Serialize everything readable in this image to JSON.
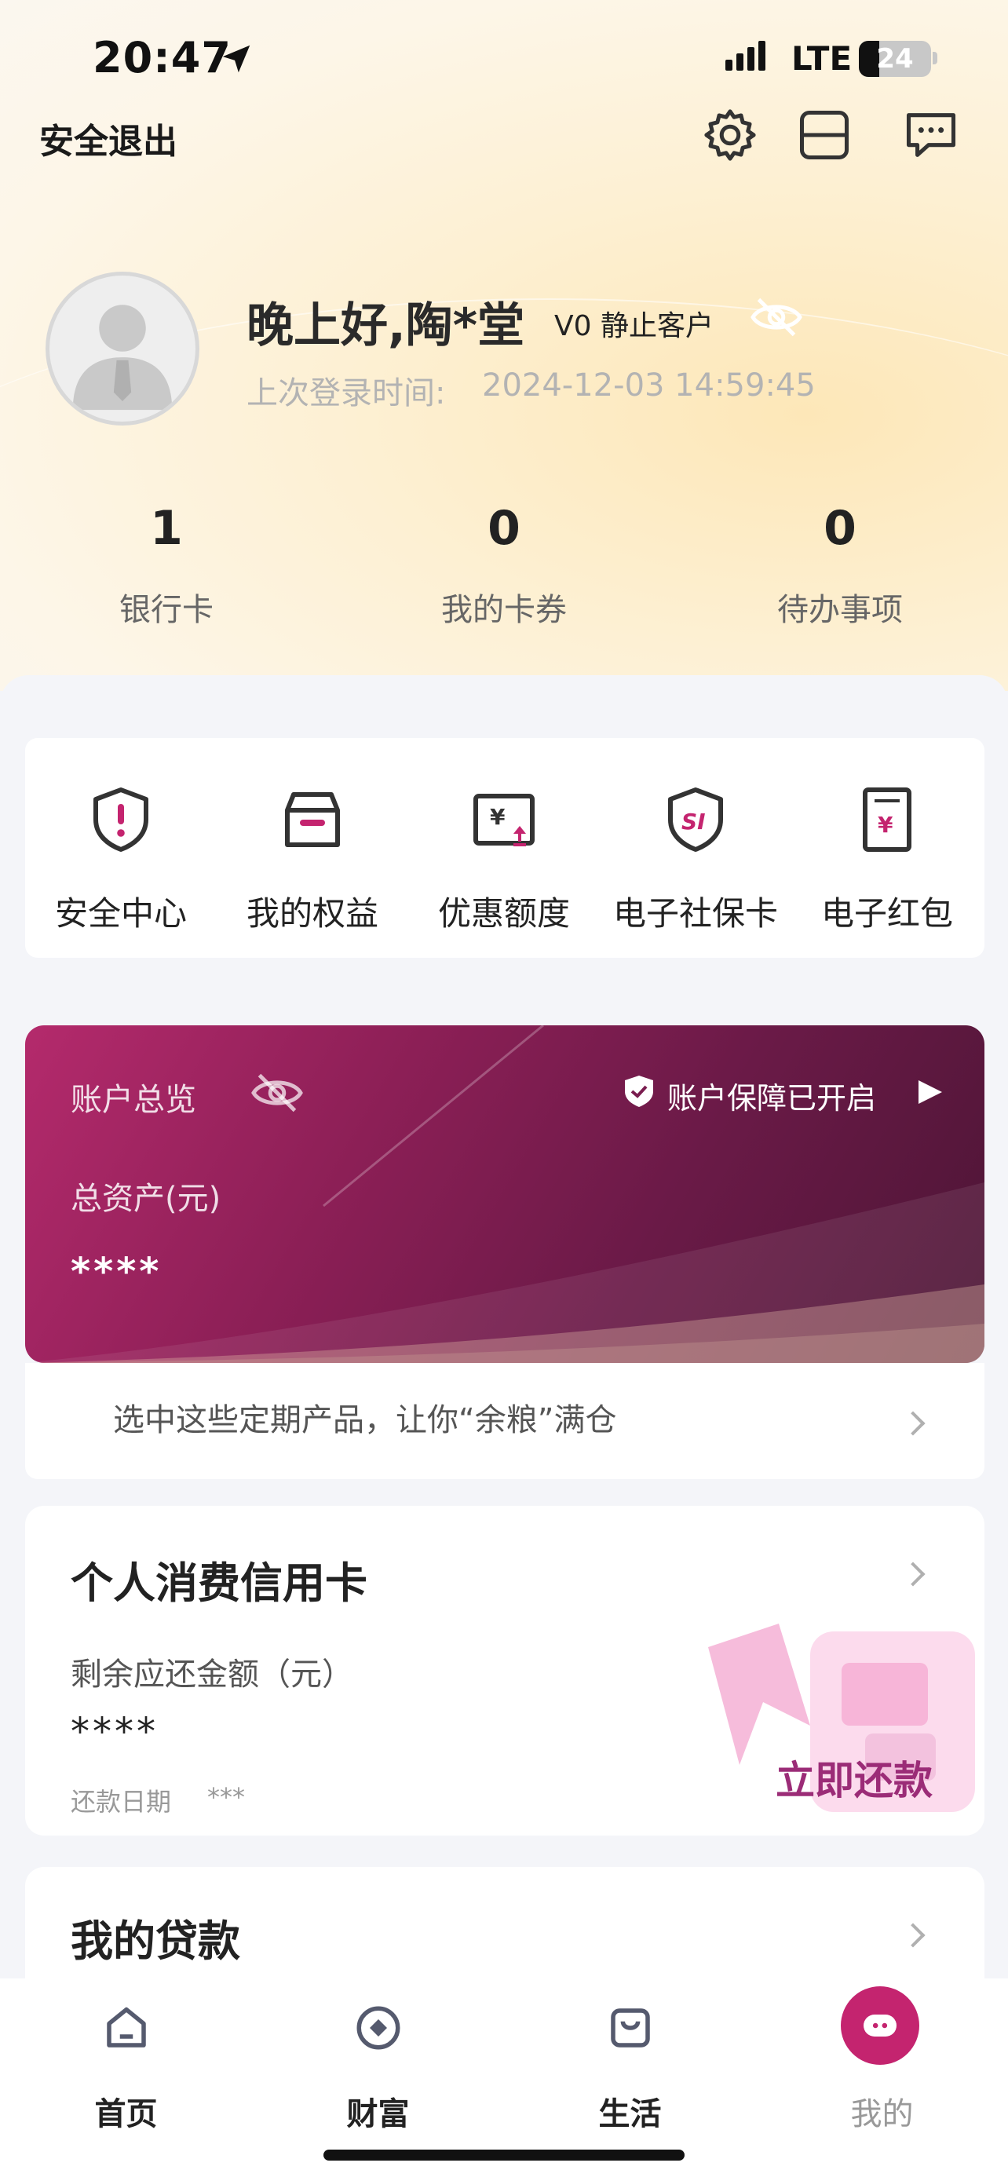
{
  "status_bar": {
    "time": "20:47",
    "network": "LTE",
    "battery": "24"
  },
  "header": {
    "logout_label": "安全退出"
  },
  "profile": {
    "greeting": "晚上好,陶*堂",
    "level": "V0 静止客户",
    "last_login_label": "上次登录时间:",
    "last_login_value": "2024-12-03 14:59:45"
  },
  "stats": [
    {
      "value": "1",
      "label": "银行卡"
    },
    {
      "value": "0",
      "label": "我的卡券"
    },
    {
      "value": "0",
      "label": "待办事项"
    }
  ],
  "quick_actions": [
    {
      "label": "安全中心",
      "icon": "shield-alert-icon"
    },
    {
      "label": "我的权益",
      "icon": "box-icon"
    },
    {
      "label": "优惠额度",
      "icon": "coupon-icon"
    },
    {
      "label": "电子社保卡",
      "icon": "social-security-icon"
    },
    {
      "label": "电子红包",
      "icon": "red-envelope-icon"
    }
  ],
  "account": {
    "title": "账户总览",
    "protection": "账户保障已开启",
    "total_label": "总资产(元)",
    "total_value": "****",
    "promo": "选中这些定期产品，让你“余粮”满仓"
  },
  "credit_card": {
    "title": "个人消费信用卡",
    "balance_label": "剩余应还金额（元）",
    "balance_value": "****",
    "due_label": "还款日期",
    "due_value": "***",
    "pay_label": "立即还款"
  },
  "loan": {
    "title": "我的贷款"
  },
  "tabs": [
    {
      "label": "首页",
      "icon": "home-icon"
    },
    {
      "label": "财富",
      "icon": "wealth-icon"
    },
    {
      "label": "生活",
      "icon": "life-bag-icon"
    },
    {
      "label": "我的",
      "icon": "me-icon",
      "active": true
    }
  ],
  "colors": {
    "accent": "#c4246f",
    "card_start": "#b42a6c",
    "card_end": "#4c1535",
    "pay_text": "#9b2c77"
  }
}
